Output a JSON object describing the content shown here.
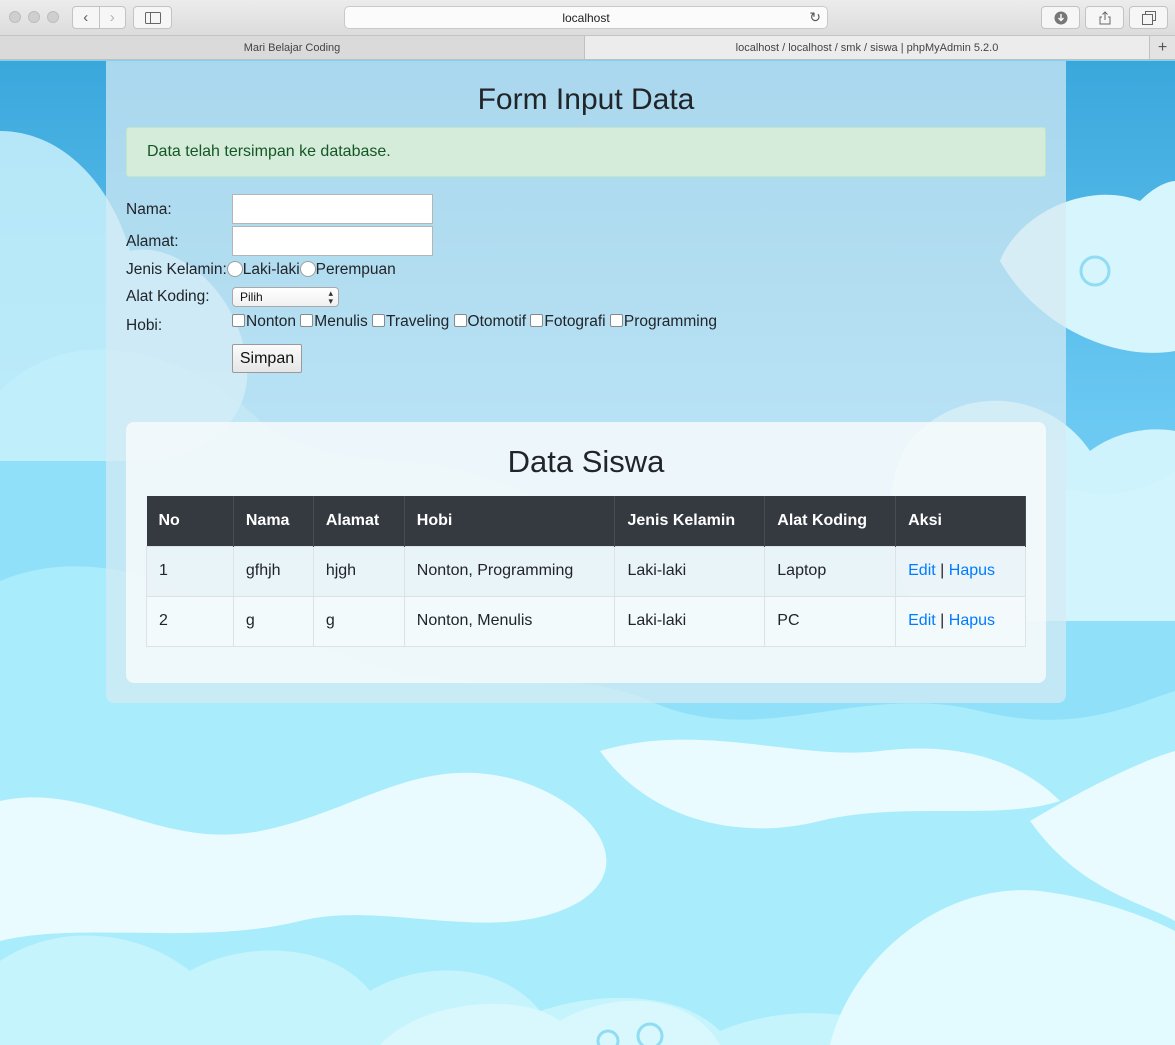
{
  "browser": {
    "url": "localhost",
    "tabs": [
      {
        "label": "Mari Belajar Coding",
        "active": false
      },
      {
        "label": "localhost / localhost / smk / siswa | phpMyAdmin 5.2.0",
        "active": true
      }
    ],
    "new_tab": "+"
  },
  "form": {
    "title": "Form Input Data",
    "alert": "Data telah tersimpan ke database.",
    "nama_label": "Nama:",
    "nama_value": "",
    "alamat_label": "Alamat:",
    "alamat_value": "",
    "jk_label": "Jenis Kelamin:",
    "jk_options": [
      "Laki-laki",
      "Perempuan"
    ],
    "alat_label": "Alat Koding:",
    "alat_selected": "Pilih",
    "hobi_label": "Hobi:",
    "hobi_options": [
      "Nonton",
      "Menulis",
      "Traveling",
      "Otomotif",
      "Fotografi",
      "Programming"
    ],
    "submit": "Simpan"
  },
  "table": {
    "title": "Data Siswa",
    "headers": [
      "No",
      "Nama",
      "Alamat",
      "Hobi",
      "Jenis Kelamin",
      "Alat Koding",
      "Aksi"
    ],
    "rows": [
      {
        "no": "1",
        "nama": "gfhjh",
        "alamat": "hjgh",
        "hobi": "Nonton, Programming",
        "jk": "Laki-laki",
        "alat": "Laptop",
        "edit": "Edit",
        "sep": "|",
        "hapus": "Hapus"
      },
      {
        "no": "2",
        "nama": "g",
        "alamat": "g",
        "hobi": "Nonton, Menulis",
        "jk": "Laki-laki",
        "alat": "PC",
        "edit": "Edit",
        "sep": "|",
        "hapus": "Hapus"
      }
    ]
  },
  "colors": {
    "header_bg": "#343a40",
    "link": "#007bff",
    "alert_bg": "#d4ecd9",
    "alert_text": "#155724",
    "sky": "#86d8f7"
  }
}
